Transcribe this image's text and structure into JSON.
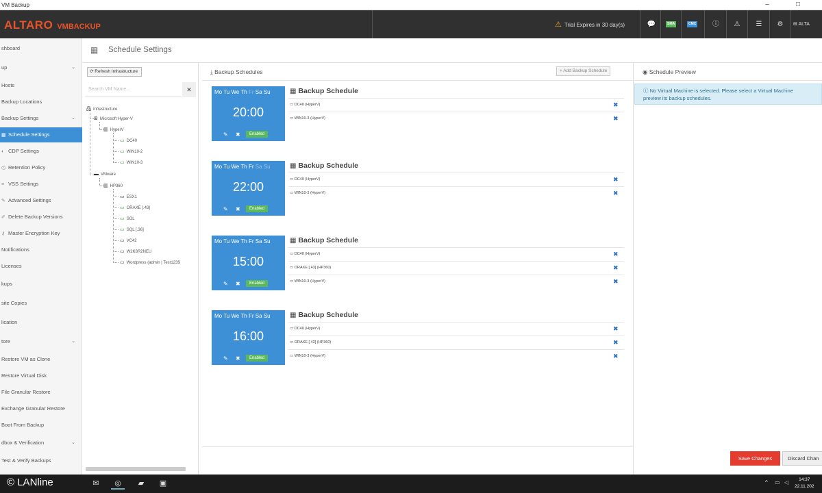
{
  "window": {
    "title": "VM Backup"
  },
  "header": {
    "brand": "ALTARO",
    "product_prefix": "VM",
    "product_suffix": "BACKUP",
    "trial": "Trial Expires in 30 day(s)",
    "badge_sma": "SMA",
    "badge_cmc": "CMC",
    "right_label": "ALTA",
    "colors": {
      "bar": "#303030",
      "brand": "#e8532a"
    }
  },
  "sidebar": {
    "items": [
      {
        "label": "shboard"
      },
      {
        "label": "up"
      },
      {
        "label": "Hosts"
      },
      {
        "label": "Backup Locations"
      },
      {
        "label": "Backup Settings"
      },
      {
        "label": "Schedule Settings"
      },
      {
        "label": "CDP Settings"
      },
      {
        "label": "Retention Policy"
      },
      {
        "label": "VSS Settings"
      },
      {
        "label": "Advanced Settings"
      },
      {
        "label": "Delete Backup Versions"
      },
      {
        "label": "Master Encryption Key"
      },
      {
        "label": "Notifications"
      },
      {
        "label": "Licenses"
      },
      {
        "label": "kups"
      },
      {
        "label": "site Copies"
      },
      {
        "label": "lication"
      },
      {
        "label": "tore"
      },
      {
        "label": "Restore VM as Clone"
      },
      {
        "label": "Restore Virtual Disk"
      },
      {
        "label": "File Granular Restore"
      },
      {
        "label": "Exchange Granular Restore"
      },
      {
        "label": "Boot From Backup"
      },
      {
        "label": "dbox & Verification"
      },
      {
        "label": "Test & Verify Backups"
      }
    ],
    "active_color": "#3d8fd6"
  },
  "page": {
    "title": "Schedule Settings"
  },
  "infra": {
    "refresh_label": "Refresh Infrastructure",
    "search_placeholder": "Search VM Name...",
    "tree": {
      "root": "Infrastructure",
      "hyperv_group": "Microsoft Hyper-V",
      "hyperv_host": "HyperV",
      "hyperv_vms": [
        "DC40",
        "WIN10-2",
        "WIN10-3"
      ],
      "vmware_group": "VMware",
      "vmware_host": "HP360",
      "vmware_vms": [
        "ESX1",
        "ORAXE [.43]",
        "SOL",
        "SQL [.36]",
        "VC42",
        "W2K8R2NEU",
        "Wordpress (admin | Test123$"
      ]
    }
  },
  "schedules": {
    "title": "Backup Schedules",
    "add_label": "Add Backup Schedule",
    "day_labels": [
      "Mo",
      "Tu",
      "We",
      "Th",
      "Fr",
      "Sa",
      "Su"
    ],
    "enabled_label": "Enabled",
    "items": [
      {
        "days_on": [
          true,
          true,
          true,
          true,
          false,
          true,
          true
        ],
        "time": "20:00",
        "title": "Backup Schedule",
        "vms": [
          "DC40 (HyperV)",
          "WIN10-3 (HyperV)"
        ]
      },
      {
        "days_on": [
          true,
          true,
          true,
          true,
          true,
          false,
          false
        ],
        "time": "22:00",
        "title": "Backup Schedule",
        "vms": [
          "DC40 (HyperV)",
          "WIN10-3 (HyperV)"
        ]
      },
      {
        "days_on": [
          true,
          true,
          true,
          true,
          true,
          true,
          true
        ],
        "time": "15:00",
        "title": "Backup Schedule",
        "vms": [
          "DC40 (HyperV)",
          "ORAXE [.43] (HP360)",
          "WIN10-3 (HyperV)"
        ]
      },
      {
        "days_on": [
          true,
          true,
          true,
          true,
          true,
          true,
          true
        ],
        "time": "16:00",
        "title": "Backup Schedule",
        "vms": [
          "DC40 (HyperV)",
          "ORAXE [.43] (HP360)",
          "WIN10-3 (HyperV)"
        ]
      }
    ],
    "tile_color": "#3d8fd6",
    "enabled_color": "#5cb85c"
  },
  "preview": {
    "title": "Schedule Preview",
    "info": "No Virtual Machine is selected. Please select a Virtual Machine",
    "info2": "preview its backup schedules.",
    "save_label": "Save Changes",
    "discard_label": "Discard Chan",
    "save_color": "#e53c30"
  },
  "taskbar": {
    "watermark": "© LANline",
    "time": "14:37",
    "date": "22.11.202"
  }
}
